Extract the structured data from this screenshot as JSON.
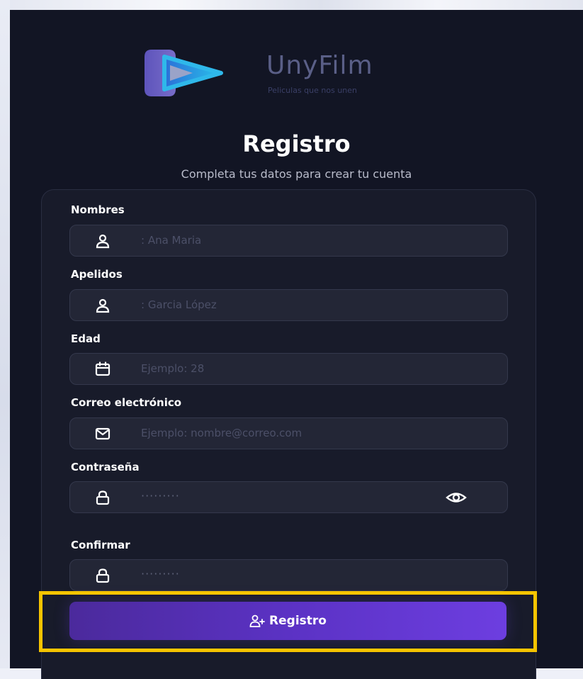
{
  "brand": {
    "name": "UnyFilm",
    "tagline": "Peliculas que nos unen",
    "logo_icon": "play-logo-icon",
    "colors": {
      "logo_purple": "#6b5fd6",
      "logo_cyan": "#29b6e8",
      "name": "#5a5f87"
    }
  },
  "header": {
    "title": "Registro",
    "subtitle": "Completa tus datos para crear tu cuenta"
  },
  "form": {
    "fields": [
      {
        "label": "Nombres",
        "placeholder": ": Ana Maria",
        "icon": "user-icon"
      },
      {
        "label": "Apelidos",
        "placeholder": ": Garcia López",
        "icon": "user-icon"
      },
      {
        "label": "Edad",
        "placeholder": "Ejemplo: 28",
        "icon": "calendar-icon"
      },
      {
        "label": "Correo electrónico",
        "placeholder": "Ejemplo: nombre@correo.com",
        "icon": "mail-icon"
      },
      {
        "label": "Contraseña",
        "placeholder": "·········",
        "icon": "lock-icon",
        "toggle_icon": "eye-icon"
      },
      {
        "label": "Confirmar",
        "placeholder": "·········",
        "icon": "lock-icon"
      }
    ],
    "submit": {
      "label": "Registro",
      "icon": "user-plus-icon"
    }
  },
  "colors": {
    "background": "#121524",
    "card": "#181b2a",
    "input": "#232636",
    "button_start": "#4b2a9c",
    "button_end": "#6d3ee0",
    "highlight": "#f6c400"
  }
}
